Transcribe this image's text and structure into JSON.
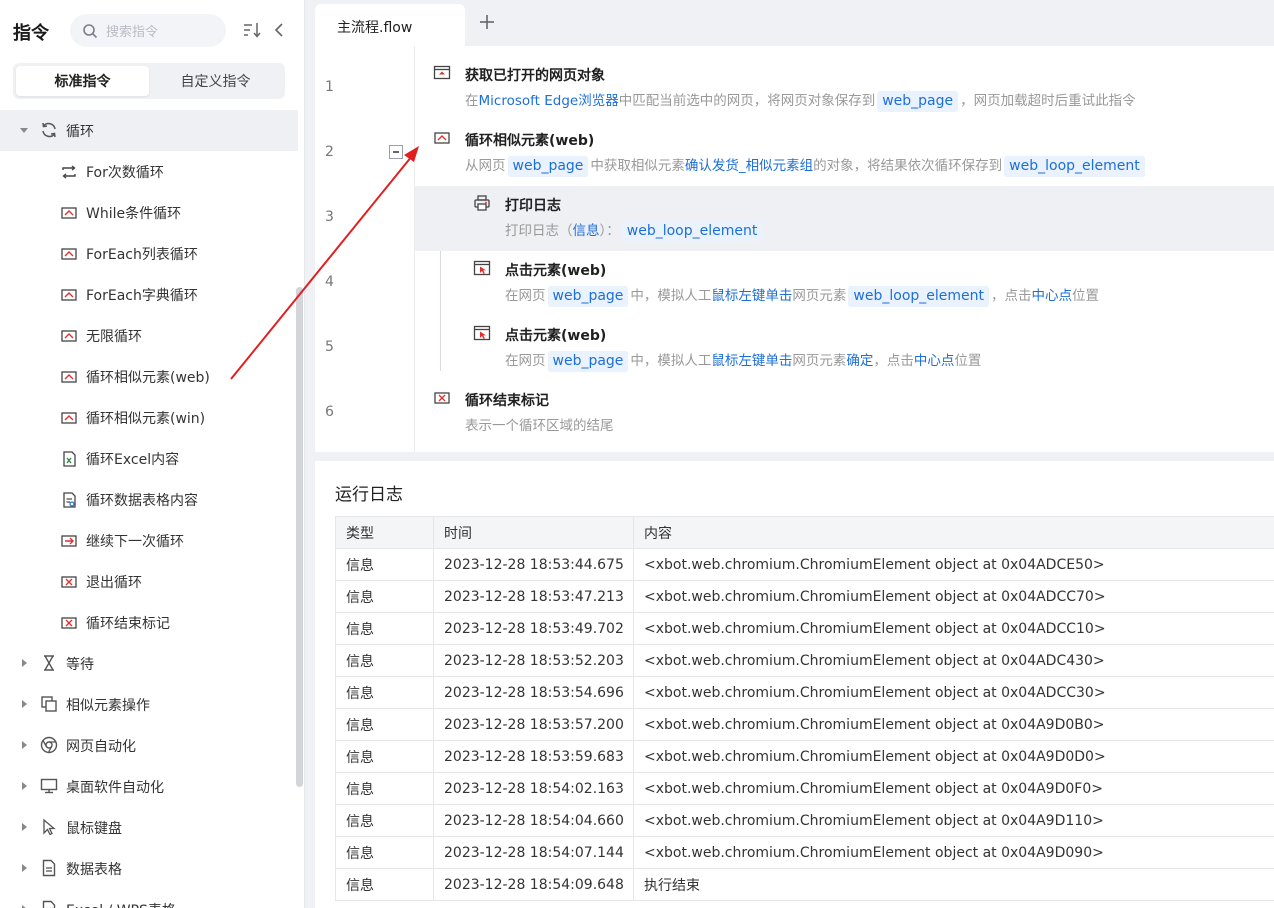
{
  "sidebar": {
    "title": "指令",
    "search_placeholder": "搜索指令",
    "tabs": [
      {
        "label": "标准指令",
        "active": true
      },
      {
        "label": "自定义指令",
        "active": false
      }
    ],
    "open_category": {
      "label": "循环",
      "icon": "refresh-icon"
    },
    "leaf_items": [
      {
        "label": "For次数循环",
        "icon": "loop-arrows-icon"
      },
      {
        "label": "While条件循环",
        "icon": "loop-box-icon"
      },
      {
        "label": "ForEach列表循环",
        "icon": "loop-box-icon"
      },
      {
        "label": "ForEach字典循环",
        "icon": "loop-box-icon"
      },
      {
        "label": "无限循环",
        "icon": "loop-box-icon"
      },
      {
        "label": "循环相似元素(web)",
        "icon": "loop-box-icon"
      },
      {
        "label": "循环相似元素(win)",
        "icon": "loop-box-icon"
      },
      {
        "label": "循环Excel内容",
        "icon": "excel-icon"
      },
      {
        "label": "循环数据表格内容",
        "icon": "table-doc-icon"
      },
      {
        "label": "继续下一次循环",
        "icon": "loop-box-icon"
      },
      {
        "label": "退出循环",
        "icon": "loop-box-icon"
      },
      {
        "label": "循环结束标记",
        "icon": "loop-box-icon"
      }
    ],
    "categories": [
      {
        "label": "等待",
        "icon": "hourglass-icon"
      },
      {
        "label": "相似元素操作",
        "icon": "copy-icon"
      },
      {
        "label": "网页自动化",
        "icon": "chrome-icon"
      },
      {
        "label": "桌面软件自动化",
        "icon": "monitor-icon"
      },
      {
        "label": "鼠标键盘",
        "icon": "cursor-icon"
      },
      {
        "label": "数据表格",
        "icon": "document-icon"
      },
      {
        "label": "Excel / WPS表格",
        "icon": "excel-icon"
      }
    ]
  },
  "editor": {
    "file_tab": "主流程.flow",
    "line_numbers": [
      "1",
      "2",
      "3",
      "4",
      "5",
      "6"
    ],
    "steps": [
      {
        "title": "获取已打开的网页对象",
        "d1": "在",
        "k1": "Microsoft Edge浏览器",
        "d2": "中匹配当前选中的网页，将网页对象保存到",
        "t1": "web_page",
        "d3": "，网页加载超时后重试此指令"
      },
      {
        "title": "循环相似元素(web)",
        "d1": "从网页",
        "t1": "web_page",
        "d2": "中获取相似元素",
        "k1": "确认发货_相似元素组",
        "d3": "的对象，将结果依次循环保存到",
        "t2": "web_loop_element"
      },
      {
        "title": "打印日志",
        "d1": "打印日志（",
        "k1": "信息",
        "d2": "）：",
        "t1": "web_loop_element"
      },
      {
        "title": "点击元素(web)",
        "d1": "在网页",
        "t1": "web_page",
        "d2": "中，模拟人工",
        "k1": "鼠标左键单击",
        "d3": "网页元素",
        "t2": "web_loop_element",
        "d4": "，点击",
        "k2": "中心点",
        "d5": "位置"
      },
      {
        "title": "点击元素(web)",
        "d1": "在网页",
        "t1": "web_page",
        "d2": "中，模拟人工",
        "k1": "鼠标左键单击",
        "d3": "网页元素",
        "k2": "确定",
        "d4": "，点击",
        "k3": "中心点",
        "d5": "位置"
      },
      {
        "title": "循环结束标记",
        "d1": "表示一个循环区域的结尾"
      }
    ]
  },
  "log": {
    "title": "运行日志",
    "columns": [
      "类型",
      "时间",
      "内容"
    ],
    "rows": [
      [
        "信息",
        "2023-12-28 18:53:44.675",
        "<xbot.web.chromium.ChromiumElement object at 0x04ADCE50>"
      ],
      [
        "信息",
        "2023-12-28 18:53:47.213",
        "<xbot.web.chromium.ChromiumElement object at 0x04ADCC70>"
      ],
      [
        "信息",
        "2023-12-28 18:53:49.702",
        "<xbot.web.chromium.ChromiumElement object at 0x04ADCC10>"
      ],
      [
        "信息",
        "2023-12-28 18:53:52.203",
        "<xbot.web.chromium.ChromiumElement object at 0x04ADC430>"
      ],
      [
        "信息",
        "2023-12-28 18:53:54.696",
        "<xbot.web.chromium.ChromiumElement object at 0x04ADCC30>"
      ],
      [
        "信息",
        "2023-12-28 18:53:57.200",
        "<xbot.web.chromium.ChromiumElement object at 0x04A9D0B0>"
      ],
      [
        "信息",
        "2023-12-28 18:53:59.683",
        "<xbot.web.chromium.ChromiumElement object at 0x04A9D0D0>"
      ],
      [
        "信息",
        "2023-12-28 18:54:02.163",
        "<xbot.web.chromium.ChromiumElement object at 0x04A9D0F0>"
      ],
      [
        "信息",
        "2023-12-28 18:54:04.660",
        "<xbot.web.chromium.ChromiumElement object at 0x04A9D110>"
      ],
      [
        "信息",
        "2023-12-28 18:54:07.144",
        "<xbot.web.chromium.ChromiumElement object at 0x04A9D090>"
      ],
      [
        "信息",
        "2023-12-28 18:54:09.648",
        "执行结束"
      ]
    ]
  },
  "colors": {
    "accent": "#1d6fd8",
    "tag_bg": "#e9f2fd",
    "annotation_arrow": "#e02020",
    "highlight_row": "#eef0f4"
  }
}
